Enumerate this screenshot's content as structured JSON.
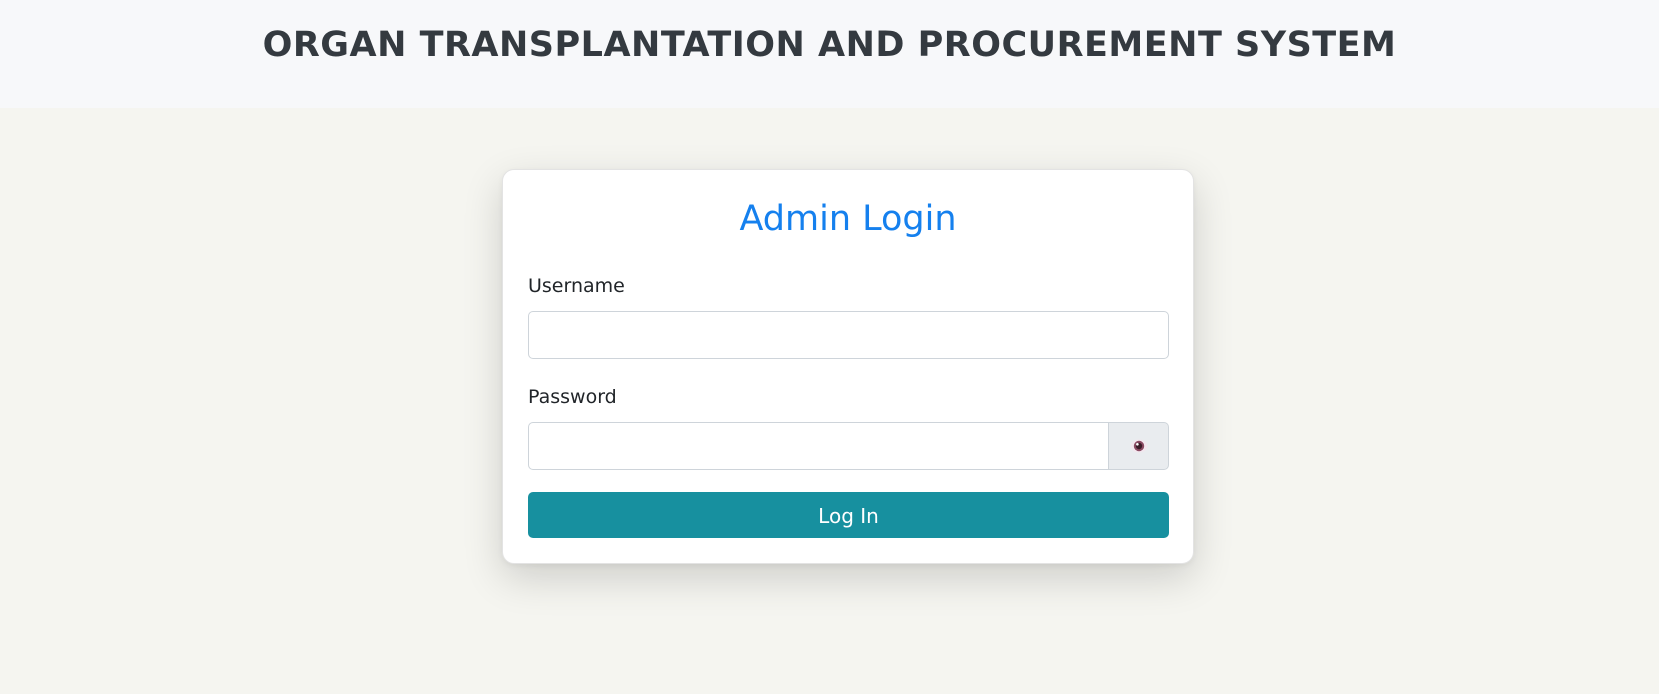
{
  "header": {
    "title": "ORGAN TRANSPLANTATION AND PROCUREMENT SYSTEM"
  },
  "login": {
    "title": "Admin Login",
    "username_label": "Username",
    "username_value": "",
    "password_label": "Password",
    "password_value": "",
    "toggle_icon": "eye-icon",
    "submit_label": "Log In"
  },
  "colors": {
    "page_background": "#f5f5f0",
    "header_background": "#f7f8fa",
    "title_text": "#343a40",
    "login_title": "#1580ee",
    "button": "#17909f",
    "button_text": "#ffffff"
  }
}
